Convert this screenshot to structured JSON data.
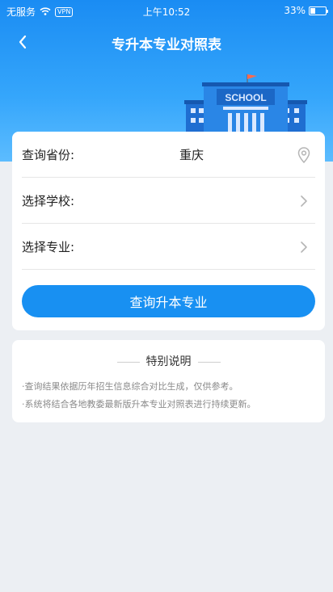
{
  "status_bar": {
    "carrier": "无服务",
    "vpn": "VPN",
    "time": "上午10:52",
    "battery": "33%",
    "battery_level": 0.33
  },
  "nav": {
    "title": "专升本专业对照表",
    "back_icon": "chevron-left-icon"
  },
  "illustration": {
    "sign_text": "SCHOOL"
  },
  "form": {
    "province": {
      "label": "查询省份:",
      "value": "重庆",
      "icon": "location-pin-icon"
    },
    "school": {
      "label": "选择学校:",
      "value": "",
      "icon": "chevron-right-icon"
    },
    "major": {
      "label": "选择专业:",
      "value": "",
      "icon": "chevron-right-icon"
    },
    "submit_label": "查询升本专业"
  },
  "notes": {
    "heading": "特别说明",
    "items": [
      "·查询结果依据历年招生信息综合对比生成，仅供参考。",
      "·系统将结合各地教委最新版升本专业对照表进行持续更新。"
    ]
  },
  "colors": {
    "accent": "#1890f2",
    "hero_top": "#1a8cf3",
    "hero_bottom": "#5cbcff"
  }
}
